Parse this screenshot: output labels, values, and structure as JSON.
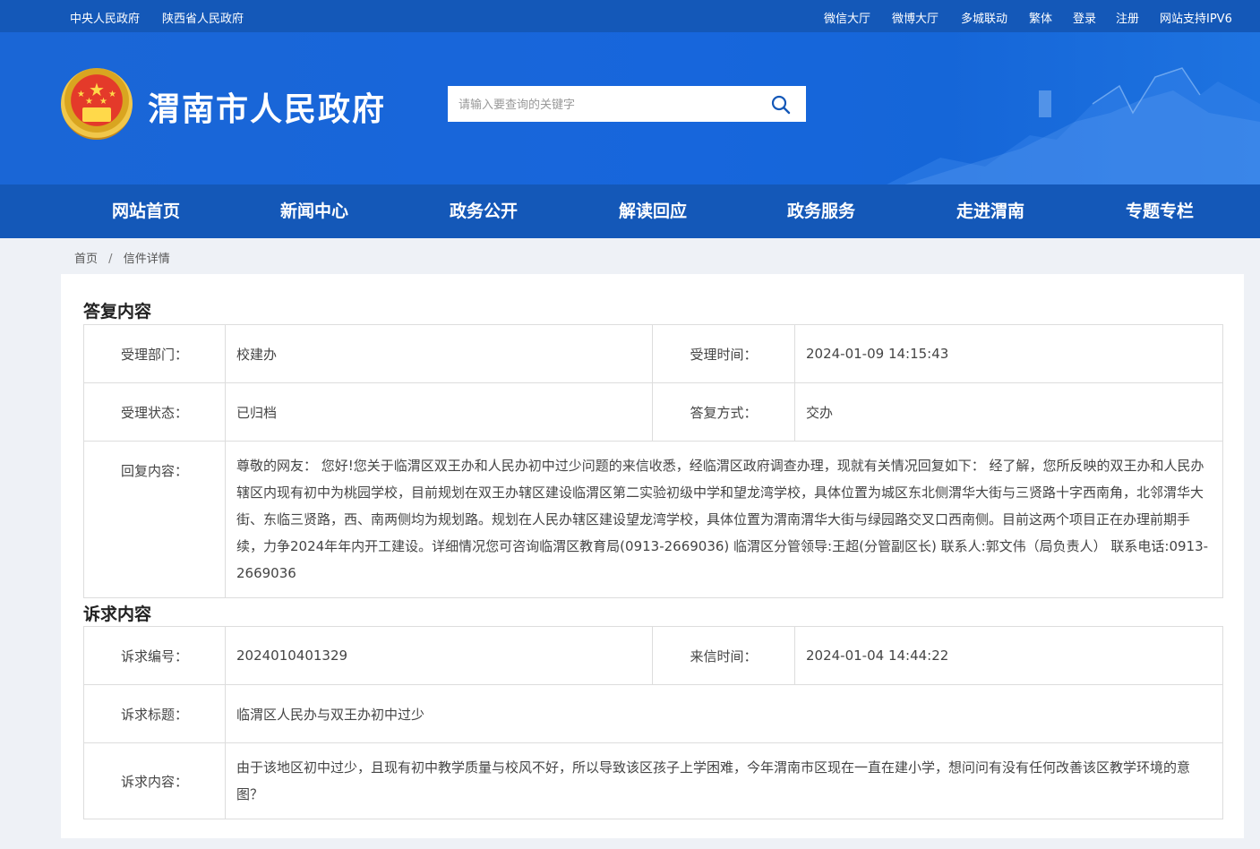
{
  "topbar": {
    "left_links": [
      "中央人民政府",
      "陕西省人民政府"
    ],
    "right_links": [
      "微信大厅",
      "微博大厅",
      "多城联动",
      "繁体",
      "登录",
      "注册",
      "网站支持IPV6"
    ]
  },
  "header": {
    "site_title": "渭南市人民政府",
    "search_placeholder": "请输入要查询的关键字",
    "search_icon": "search-icon",
    "emblem_icon": "national-emblem-icon"
  },
  "nav": {
    "items": [
      "网站首页",
      "新闻中心",
      "政务公开",
      "解读回应",
      "政务服务",
      "走进渭南",
      "专题专栏"
    ]
  },
  "breadcrumb": {
    "home": "首页",
    "separator": "/",
    "current": "信件详情"
  },
  "reply": {
    "section_title": "答复内容",
    "dept_label": "受理部门：",
    "dept_value": "校建办",
    "time_label": "受理时间：",
    "time_value": "2024-01-09 14:15:43",
    "status_label": "受理状态：",
    "status_value": "已归档",
    "method_label": "答复方式：",
    "method_value": "交办",
    "content_label": "回复内容：",
    "content_value": "尊敬的网友： 您好!您关于临渭区双王办和人民办初中过少问题的来信收悉，经临渭区政府调查办理，现就有关情况回复如下： 经了解，您所反映的双王办和人民办辖区内现有初中为桃园学校，目前规划在双王办辖区建设临渭区第二实验初级中学和望龙湾学校，具体位置为城区东北侧渭华大街与三贤路十字西南角，北邻渭华大街、东临三贤路，西、南两侧均为规划路。规划在人民办辖区建设望龙湾学校，具体位置为渭南渭华大街与绿园路交叉口西南侧。目前这两个项目正在办理前期手续，力争2024年年内开工建设。详细情况您可咨询临渭区教育局(0913-2669036) 临渭区分管领导:王超(分管副区长) 联系人:郭文伟（局负责人） 联系电话:0913-2669036"
  },
  "appeal": {
    "section_title": "诉求内容",
    "number_label": "诉求编号：",
    "number_value": "2024010401329",
    "time_label": "来信时间：",
    "time_value": "2024-01-04 14:44:22",
    "title_label": "诉求标题：",
    "title_value": "临渭区人民办与双王办初中过少",
    "content_label": "诉求内容：",
    "content_value": "由于该地区初中过少，且现有初中教学质量与校风不好，所以导致该区孩子上学困难，今年渭南市区现在一直在建小学，想问问有没有任何改善该区教学环境的意图？"
  },
  "colors": {
    "topbar": "#1458b8",
    "header": "#1766dc",
    "nav": "#1458b8",
    "page_bg": "#eef1f6"
  }
}
